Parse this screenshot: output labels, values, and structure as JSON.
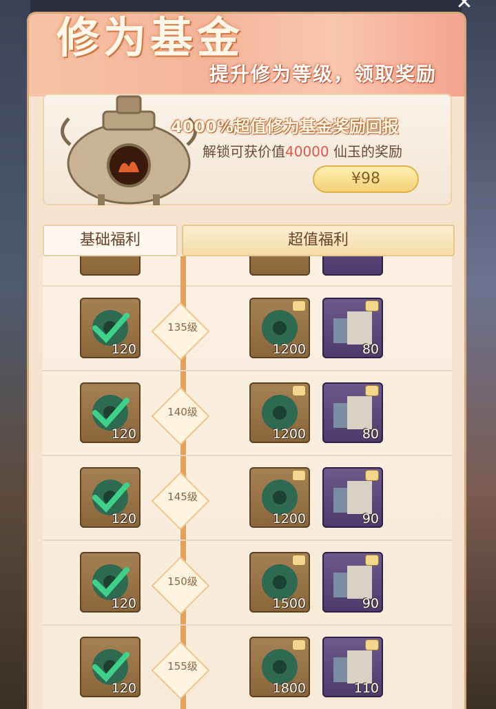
{
  "header": {
    "title": "修为基金",
    "subtitle": "提升修为等级，领取奖励",
    "close_icon": "close-icon"
  },
  "banner": {
    "headline": "4000%超值修为基金奖励回报",
    "desc_prefix": "解锁可获价值",
    "desc_amount": "40000",
    "desc_suffix": "仙玉的奖励",
    "price": "¥98",
    "image_icon": "incense-urn-icon"
  },
  "tabs": {
    "basic": "基础福利",
    "premium": "超值福利"
  },
  "rows": [
    {
      "level": "135级",
      "basic": "120",
      "p1": "1200",
      "p2": "80"
    },
    {
      "level": "140级",
      "basic": "120",
      "p1": "1200",
      "p2": "80"
    },
    {
      "level": "145级",
      "basic": "120",
      "p1": "1200",
      "p2": "90"
    },
    {
      "level": "150级",
      "basic": "120",
      "p1": "1500",
      "p2": "90"
    },
    {
      "level": "155级",
      "basic": "120",
      "p1": "1800",
      "p2": "110"
    }
  ]
}
